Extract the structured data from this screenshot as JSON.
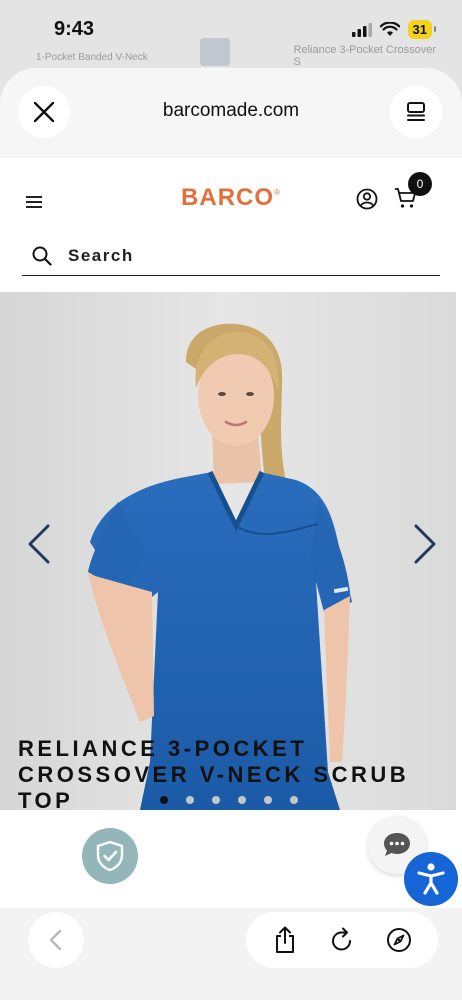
{
  "status_bar": {
    "time": "9:43",
    "battery": "31"
  },
  "background_page": {
    "left_product": "1-Pocket Banded V-Neck",
    "right_product": "Reliance 3-Pocket Crossover",
    "right_product_cont": "S"
  },
  "browser": {
    "url": "barcomade.com"
  },
  "site": {
    "logo": "BARCO",
    "logo_mark": "®",
    "cart_count": "0",
    "search_label": "Search"
  },
  "product": {
    "title": "RELIANCE 3-POCKET CROSSOVER V-NECK SCRUB TOP",
    "image_count": 6,
    "active_image": 1
  },
  "icons": {
    "close": "close-icon",
    "reader": "reader-icon",
    "menu": "hamburger-icon",
    "account": "account-icon",
    "cart": "cart-icon",
    "search": "search-icon",
    "prev": "chevron-left-icon",
    "next": "chevron-right-icon",
    "shield": "shield-check-icon",
    "chat": "chat-icon",
    "accessibility": "accessibility-icon",
    "back": "back-icon",
    "share": "share-icon",
    "reload": "reload-icon",
    "compass": "compass-icon"
  },
  "colors": {
    "brand": "#e2703a",
    "scrub_blue": "#1f63b3",
    "accessibility_blue": "#1565d6",
    "shield_teal": "#8fb3b6"
  }
}
